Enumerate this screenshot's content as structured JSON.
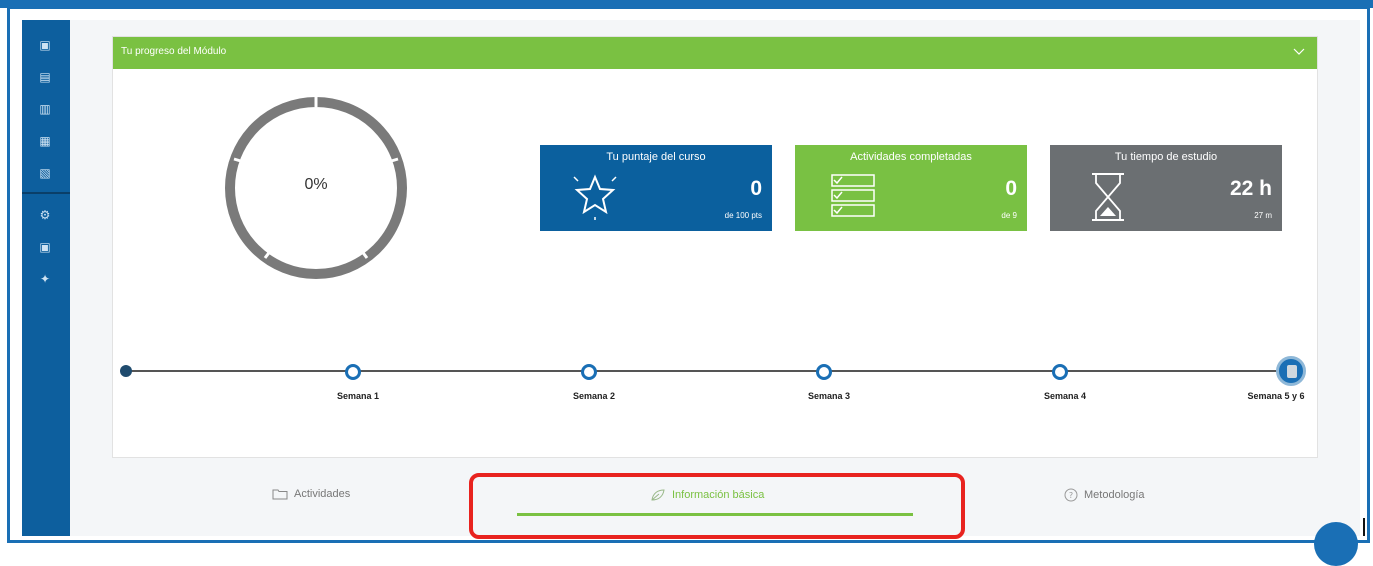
{
  "sidebar": {
    "icons": [
      "dashboard-icon",
      "monitor-icon",
      "book-icon",
      "calendar-icon",
      "notes-icon",
      "search-settings-icon",
      "inbox-icon",
      "globe-icon"
    ]
  },
  "card": {
    "title": "Tu progreso del Módulo",
    "collapse_icon": "chevron-down-icon"
  },
  "progress": {
    "percent_label": "0%",
    "value": 0
  },
  "stats": {
    "score": {
      "title": "Tu puntaje del curso",
      "value": "0",
      "sub": "de 100 pts",
      "color": "#0b609e",
      "icon": "star-icon"
    },
    "activities": {
      "title": "Actividades completadas",
      "value": "0",
      "sub": "de 9",
      "color": "#79c143",
      "icon": "checklist-icon"
    },
    "time": {
      "title": "Tu tiempo de estudio",
      "value": "22 h",
      "sub": "27 m",
      "color": "#6b6f72",
      "icon": "hourglass-icon"
    }
  },
  "timeline": {
    "weeks": [
      "Semana 1",
      "Semana 2",
      "Semana 3",
      "Semana 4",
      "Semana 5 y 6"
    ]
  },
  "tabs": [
    {
      "label": "Actividades",
      "icon": "folder-icon",
      "active": false
    },
    {
      "label": "Información básica",
      "icon": "leaf-icon",
      "active": true
    },
    {
      "label": "Metodología",
      "icon": "help-circle-icon",
      "active": false
    }
  ],
  "colors": {
    "accent_green": "#7ac142",
    "brand_blue": "#1a6fb5",
    "highlight_red": "#e8231f"
  }
}
